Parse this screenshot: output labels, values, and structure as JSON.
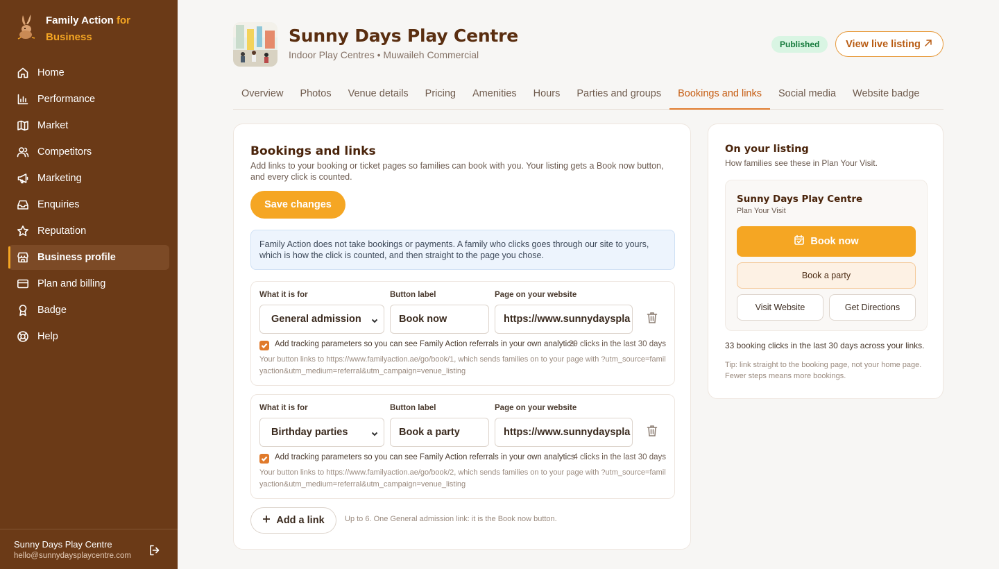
{
  "brand": {
    "name_part1": "Family Action ",
    "name_accent": "for",
    "name_part2": "Business"
  },
  "nav": {
    "items": [
      {
        "label": "Home",
        "icon": "home-icon"
      },
      {
        "label": "Performance",
        "icon": "chart-icon"
      },
      {
        "label": "Market",
        "icon": "map-icon"
      },
      {
        "label": "Competitors",
        "icon": "users-icon"
      },
      {
        "label": "Marketing",
        "icon": "megaphone-icon"
      },
      {
        "label": "Enquiries",
        "icon": "inbox-icon"
      },
      {
        "label": "Reputation",
        "icon": "star-icon"
      },
      {
        "label": "Business profile",
        "icon": "store-icon",
        "active": true
      },
      {
        "label": "Plan and billing",
        "icon": "card-icon"
      },
      {
        "label": "Badge",
        "icon": "award-icon"
      },
      {
        "label": "Help",
        "icon": "lifebuoy-icon"
      }
    ]
  },
  "account": {
    "name": "Sunny Days Play Centre",
    "email": "hello@sunnydaysplaycentre.com"
  },
  "header": {
    "title": "Sunny Days Play Centre",
    "subtitle": "Indoor Play Centres • Muwaileh Commercial",
    "status": "Published",
    "view_live": "View live listing"
  },
  "tabs": [
    "Overview",
    "Photos",
    "Venue details",
    "Pricing",
    "Amenities",
    "Hours",
    "Parties and groups",
    "Bookings and links",
    "Social media",
    "Website badge"
  ],
  "active_tab": "Bookings and links",
  "bookings": {
    "title": "Bookings and links",
    "description": "Add links to your booking or ticket pages so families can book with you. Your listing gets a Book now button, and every click is counted.",
    "save_label": "Save changes",
    "info": "Family Action does not take bookings or payments. A family who clicks goes through our site to yours, which is how the click is counted, and then straight to the page you chose.",
    "col_purpose": "What it is for",
    "col_label": "Button label",
    "col_url": "Page on your website",
    "tracking_label": "Add tracking parameters so you can see Family Action referrals in your own analytics",
    "links": [
      {
        "purpose": "General admission",
        "label": "Book now",
        "url": "https://www.sunnydaysplaycentre.com/tickets",
        "url_visible": "https://www.sunnydayspla",
        "clicks": "29 clicks in the last 30 days",
        "hint": "Your button links to https://www.familyaction.ae/go/book/1, which sends families on to your page with ?utm_source=familyaction&utm_medium=referral&utm_campaign=venue_listing",
        "tracking": true
      },
      {
        "purpose": "Birthday parties",
        "label": "Book a party",
        "url": "https://www.sunnydaysplaycentre.com/parties",
        "url_visible": "https://www.sunnydayspla",
        "clicks": "4 clicks in the last 30 days",
        "hint": "Your button links to https://www.familyaction.ae/go/book/2, which sends families on to your page with ?utm_source=familyaction&utm_medium=referral&utm_campaign=venue_listing",
        "tracking": true
      }
    ],
    "add_label": "Add a link",
    "add_hint": "Up to 6. One General admission link: it is the Book now button."
  },
  "preview": {
    "title": "On your listing",
    "subtitle": "How families see these in Plan Your Visit.",
    "venue": "Sunny Days Play Centre",
    "section": "Plan Your Visit",
    "book_now": "Book now",
    "book_party": "Book a party",
    "visit_website": "Visit Website",
    "get_directions": "Get Directions",
    "stat": "33 booking clicks in the last 30 days across your links.",
    "tip": "Tip: link straight to the booking page, not your home page. Fewer steps means more bookings."
  },
  "colors": {
    "sidebar": "#6b3a17",
    "accent": "#f5a623",
    "tab_active": "#c65d12"
  }
}
